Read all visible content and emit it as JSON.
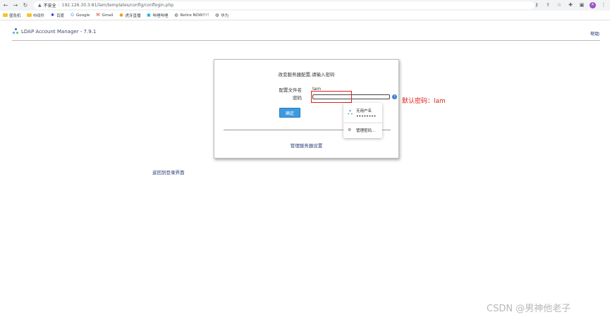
{
  "browser": {
    "security_label": "不安全",
    "url": "192.126.30.3:81/lam/templates/config/conflogin.php",
    "profile_initial": "A",
    "bookmarks": [
      "盛免机",
      "中间件",
      "百度",
      "Google",
      "Gmail",
      "虎牙直播",
      "哔哩哔哩",
      "Retire NOW!!!!",
      "华为"
    ]
  },
  "header": {
    "app_title": "LDAP Account Manager - 7.9.1",
    "help_label": "帮助"
  },
  "login_box": {
    "title": "改变服务器配置,请输入密码",
    "profile_label": "配置文件名",
    "profile_value": "lam",
    "password_label": "密码",
    "password_value": "",
    "help_icon_text": "?",
    "ok_label": "确定",
    "manage_link": "管理服务器设置"
  },
  "annotation": {
    "note": "默认密码：lam",
    "highlight_color": "#e0201c"
  },
  "autofill": {
    "username": "无用户名",
    "password_mask": "••••••••",
    "manage_passwords": "管理密码..."
  },
  "back_link": "返回到登录界面",
  "watermark": "CSDN @男神他老子",
  "colors": {
    "link": "#2b3c78",
    "button": "#3d9ae0",
    "help_icon": "#3c7bd6"
  }
}
